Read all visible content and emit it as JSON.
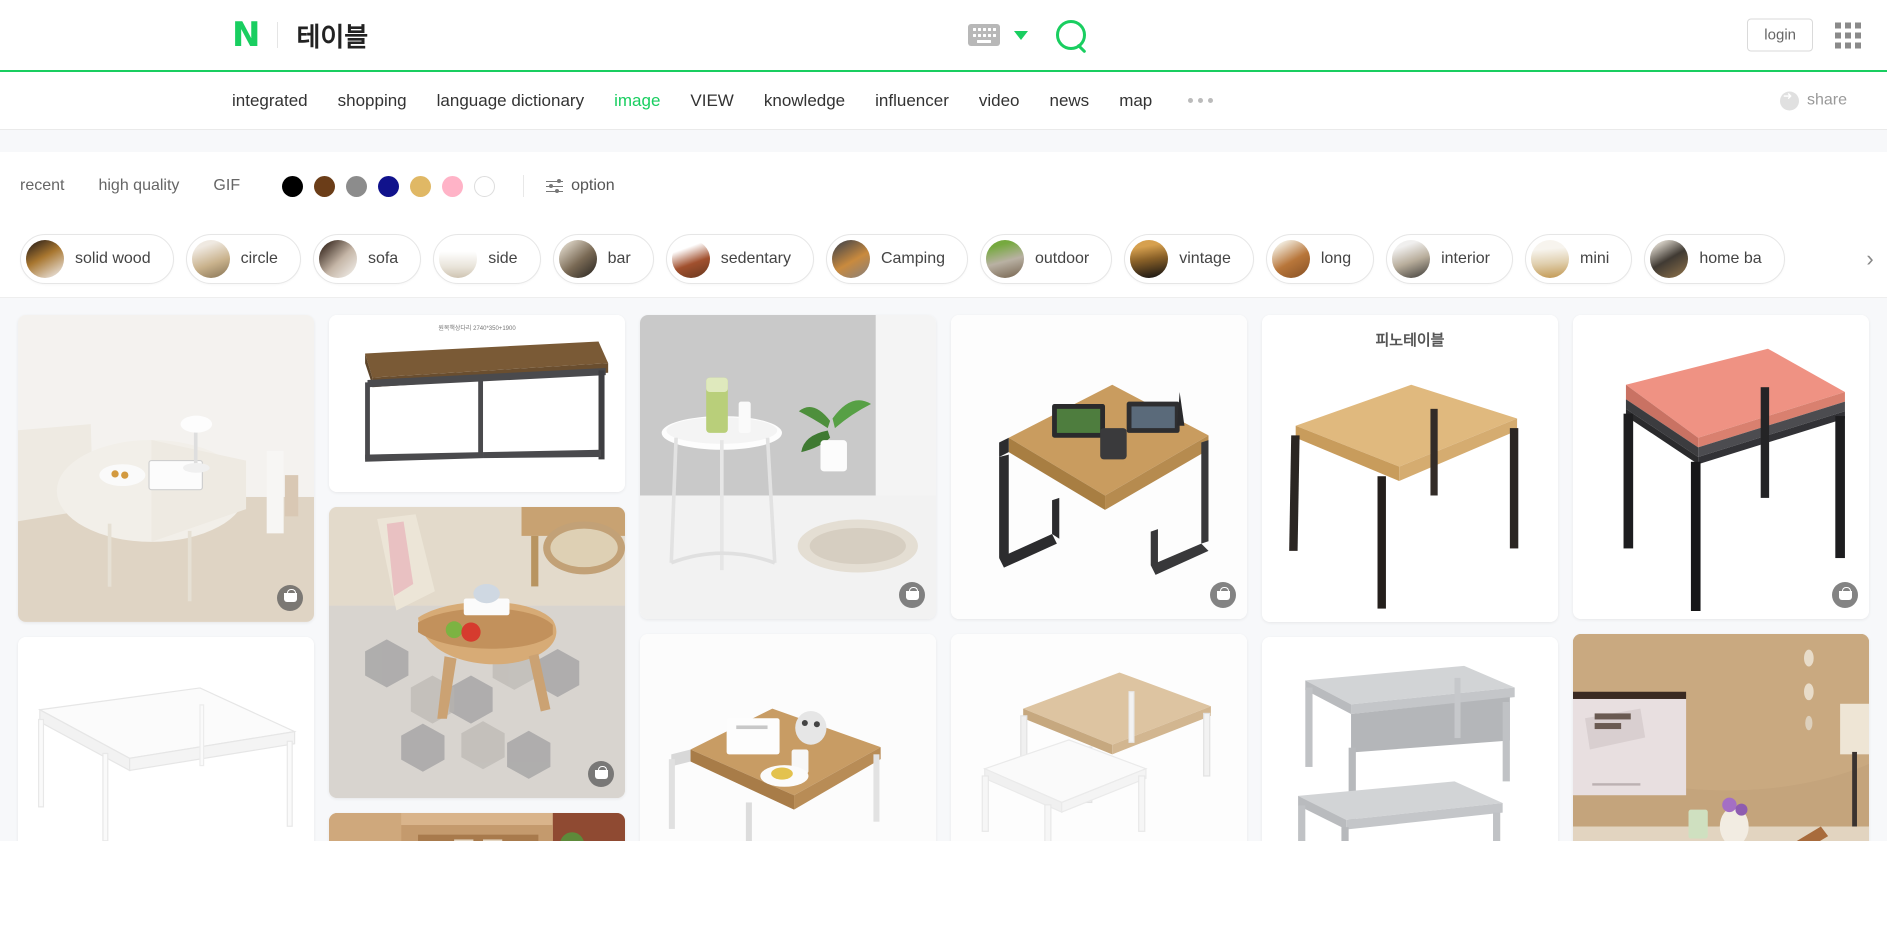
{
  "header": {
    "logo_text": "N",
    "query": "테이블",
    "keyboard_icon": "keyboard-icon",
    "dropdown_icon": "chevron-down-icon",
    "search_icon": "search-icon",
    "login_label": "login",
    "apps_icon": "apps-grid-icon"
  },
  "nav": {
    "items": [
      {
        "label": "integrated",
        "active": false
      },
      {
        "label": "shopping",
        "active": false
      },
      {
        "label": "language dictionary",
        "active": false
      },
      {
        "label": "image",
        "active": true
      },
      {
        "label": "VIEW",
        "active": false
      },
      {
        "label": "knowledge",
        "active": false
      },
      {
        "label": "influencer",
        "active": false
      },
      {
        "label": "video",
        "active": false
      },
      {
        "label": "news",
        "active": false
      },
      {
        "label": "map",
        "active": false
      }
    ],
    "more_icon": "more-dots-icon",
    "share_label": "share",
    "share_icon": "share-icon"
  },
  "filters": {
    "links": [
      "recent",
      "high quality",
      "GIF"
    ],
    "colors": [
      {
        "name": "black",
        "hex": "#000000"
      },
      {
        "name": "brown",
        "hex": "#6b3d18"
      },
      {
        "name": "gray",
        "hex": "#8c8c8c"
      },
      {
        "name": "navy",
        "hex": "#10128c"
      },
      {
        "name": "gold",
        "hex": "#e0b865"
      },
      {
        "name": "pink",
        "hex": "#ffb3c7"
      },
      {
        "name": "white",
        "hex": "#ffffff"
      }
    ],
    "option_label": "option",
    "option_icon": "sliders-icon"
  },
  "chips": {
    "items": [
      {
        "label": "solid wood"
      },
      {
        "label": "circle"
      },
      {
        "label": "sofa"
      },
      {
        "label": "side"
      },
      {
        "label": "bar"
      },
      {
        "label": "sedentary"
      },
      {
        "label": "Camping"
      },
      {
        "label": "outdoor"
      },
      {
        "label": "vintage"
      },
      {
        "label": "long"
      },
      {
        "label": "interior"
      },
      {
        "label": "mini"
      },
      {
        "label": "home ba"
      }
    ],
    "next_icon": "chevron-right-icon"
  },
  "results": {
    "columns": [
      {
        "tiles": [
          {
            "name": "white-oval-folding-table-room",
            "caption": "",
            "note": "",
            "cart": true
          },
          {
            "name": "white-rect-frame-table",
            "caption": "",
            "note": "",
            "cart": false
          }
        ]
      },
      {
        "tiles": [
          {
            "name": "wood-top-steel-long-console",
            "caption": "",
            "note": "원목책상다리 2740*350+1900",
            "cart": false
          },
          {
            "name": "wood-round-coffee-table-rug",
            "caption": "",
            "note": "",
            "cart": true
          },
          {
            "name": "dining-room-wood-set",
            "caption": "",
            "note": "",
            "cart": false
          }
        ]
      },
      {
        "tiles": [
          {
            "name": "white-round-side-table-plant",
            "caption": "",
            "note": "",
            "cart": true
          },
          {
            "name": "wood-top-white-leg-tea-table",
            "caption": "",
            "note": "",
            "cart": false
          }
        ]
      },
      {
        "tiles": [
          {
            "name": "wood-steel-leg-low-table",
            "caption": "",
            "note": "",
            "cart": true
          },
          {
            "name": "white-leg-square-table",
            "caption": "",
            "note": "",
            "cart": false
          }
        ]
      },
      {
        "tiles": [
          {
            "name": "pino-table-product",
            "caption": "피노테이블",
            "note": "",
            "cart": false
          },
          {
            "name": "grey-school-desk-pair",
            "caption": "",
            "note": "",
            "cart": false
          }
        ]
      },
      {
        "tiles": [
          {
            "name": "pink-top-black-leg-table",
            "caption": "",
            "note": "",
            "cart": true
          },
          {
            "name": "interior-poster-wall-scene",
            "caption": "",
            "note": "",
            "cart": false
          }
        ]
      }
    ]
  }
}
